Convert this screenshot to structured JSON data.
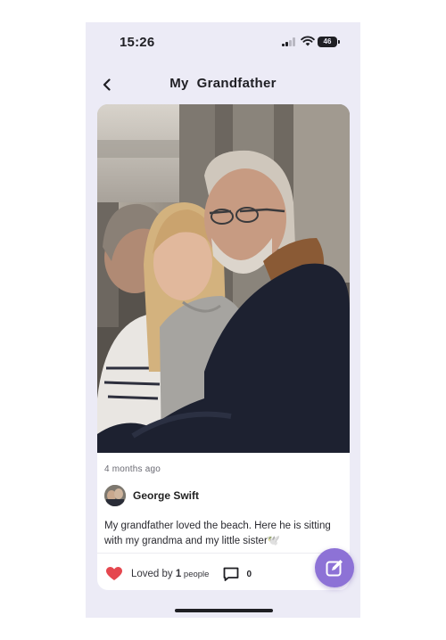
{
  "status_bar": {
    "time": "15:26",
    "battery": "46"
  },
  "header": {
    "title": "My  Grandfather"
  },
  "post": {
    "timestamp": "4 months ago",
    "author": "George Swift",
    "text": "My grandfather loved the beach. Here he is sitting with my grandma and my little sister🕊️",
    "loved_prefix": "Loved by ",
    "loved_count": "1",
    "loved_suffix": " people",
    "comment_count": "0"
  },
  "icons": {
    "back": "chevron-left-icon",
    "love": "heart-icon",
    "comment": "comment-icon",
    "fab": "edit-icon"
  },
  "colors": {
    "background": "#ecebf6",
    "accent": "#8d72d6",
    "heart": "#e5474f"
  }
}
